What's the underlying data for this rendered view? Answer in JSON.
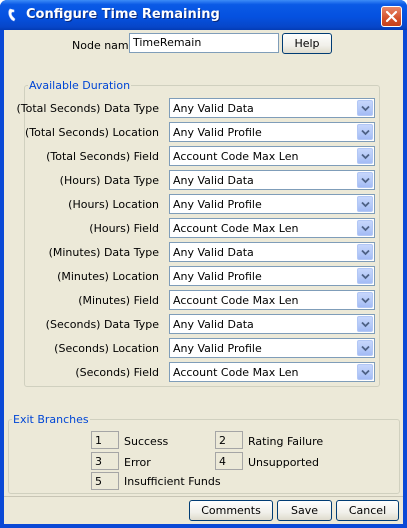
{
  "window": {
    "title": "Configure Time Remaining"
  },
  "form": {
    "node_name_label": "Node name",
    "node_name_value": "TimeRemain",
    "help_label": "Help"
  },
  "duration": {
    "title": "Available Duration",
    "rows": [
      {
        "label": "(Total Seconds) Data Type",
        "value": "Any Valid Data"
      },
      {
        "label": "(Total Seconds) Location",
        "value": "Any Valid Profile"
      },
      {
        "label": "(Total Seconds) Field",
        "value": "Account Code Max Len"
      },
      {
        "label": "(Hours) Data Type",
        "value": "Any Valid Data"
      },
      {
        "label": "(Hours) Location",
        "value": "Any Valid Profile"
      },
      {
        "label": "(Hours) Field",
        "value": "Account Code Max Len"
      },
      {
        "label": "(Minutes) Data Type",
        "value": "Any Valid Data"
      },
      {
        "label": "(Minutes) Location",
        "value": "Any Valid Profile"
      },
      {
        "label": "(Minutes) Field",
        "value": "Account Code Max Len"
      },
      {
        "label": "(Seconds) Data Type",
        "value": "Any Valid Data"
      },
      {
        "label": "(Seconds) Location",
        "value": "Any Valid Profile"
      },
      {
        "label": "(Seconds) Field",
        "value": "Account Code Max Len"
      }
    ]
  },
  "exit_branches": {
    "title": "Exit Branches",
    "items": [
      {
        "num": "1",
        "label": "Success"
      },
      {
        "num": "2",
        "label": "Rating Failure"
      },
      {
        "num": "3",
        "label": "Error"
      },
      {
        "num": "4",
        "label": "Unsupported"
      },
      {
        "num": "5",
        "label": "Insufficient Funds"
      }
    ]
  },
  "footer": {
    "comments_label": "Comments",
    "save_label": "Save",
    "cancel_label": "Cancel"
  },
  "colors": {
    "title_bar": "#0551e0",
    "dialog_bg": "#ece9d8",
    "group_title": "#0046d5",
    "close_button": "#d4512a"
  }
}
